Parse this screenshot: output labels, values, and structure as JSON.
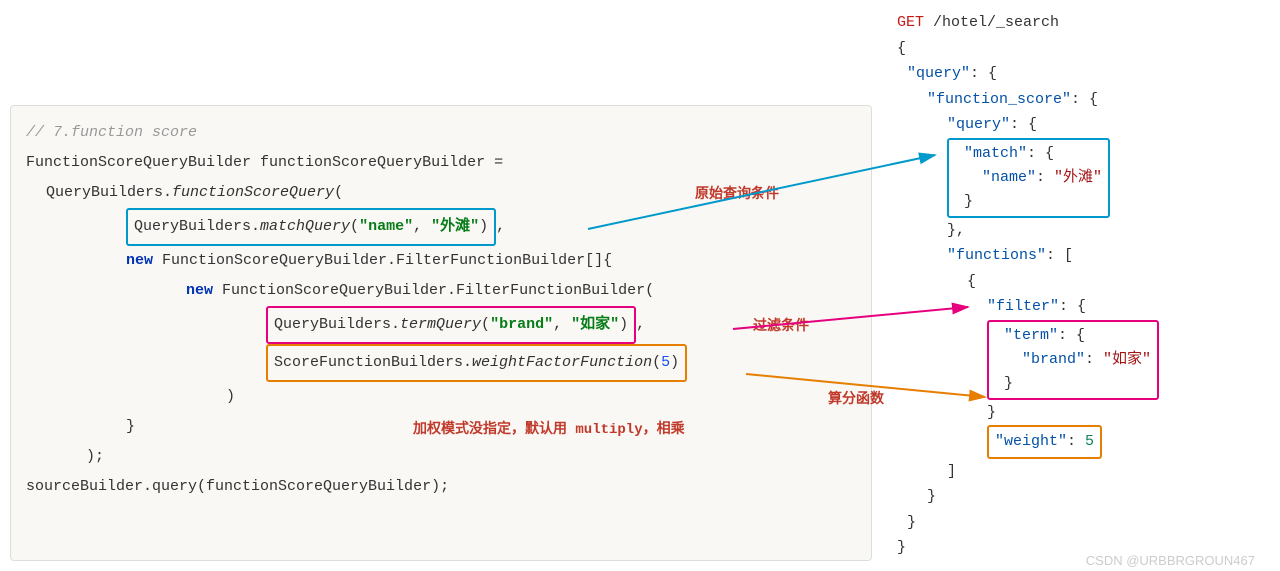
{
  "left": {
    "comment": "// 7.function score",
    "line2": {
      "a": "FunctionScoreQueryBuilder functionScoreQueryBuilder ="
    },
    "line3": {
      "a": "QueryBuilders.",
      "b": "functionScoreQuery",
      "c": "("
    },
    "line4": {
      "a": "QueryBuilders.",
      "b": "matchQuery",
      "c": "(\"name\", \"外滩\")",
      "tail": ","
    },
    "line5": {
      "kw": "new",
      "a": " FunctionScoreQueryBuilder.FilterFunctionBuilder[]{"
    },
    "line6": {
      "kw": "new",
      "a": " FunctionScoreQueryBuilder.FilterFunctionBuilder("
    },
    "line7": {
      "a": "QueryBuilders.",
      "b": "termQuery",
      "c": "(\"brand\", \"如家\")",
      "tail": ","
    },
    "line8": {
      "a": "ScoreFunctionBuilders.",
      "b": "weightFactorFunction",
      "c": "(",
      "num": "5",
      "d": ")"
    },
    "line9": ")",
    "line10": "}",
    "line11": ");",
    "line12": "sourceBuilder.query(functionScoreQueryBuilder);"
  },
  "labels": {
    "l1": "原始查询条件",
    "l2": "过滤条件",
    "l3": "算分函数",
    "l4": "加权模式没指定，默认用 multiply，相乘"
  },
  "right": {
    "l1a": "GET",
    "l1b": " /hotel/_search",
    "l2": "{",
    "l3a": "\"query\"",
    "l3b": ": {",
    "l4a": "\"function_score\"",
    "l4b": ": {",
    "l5a": "\"query\"",
    "l5b": ": {",
    "l6a": "\"match\"",
    "l6b": ": {",
    "l7a": "\"name\"",
    "l7b": ": ",
    "l7c": "\"外滩\"",
    "l8": "}",
    "l9": "},",
    "l10a": "\"functions\"",
    "l10b": ": [",
    "l11": "{",
    "l12a": "\"filter\"",
    "l12b": ": {",
    "l13a": "\"term\"",
    "l13b": ": {",
    "l14a": "\"brand\"",
    "l14b": ": ",
    "l14c": "\"如家\"",
    "l15": "}",
    "l16": "}",
    "l17a": "\"weight\"",
    "l17b": ": ",
    "l17c": "5",
    "l18": "]",
    "l19": "}",
    "l20": "}",
    "l21": "}"
  },
  "watermark": "CSDN @URBBRGROUN467"
}
